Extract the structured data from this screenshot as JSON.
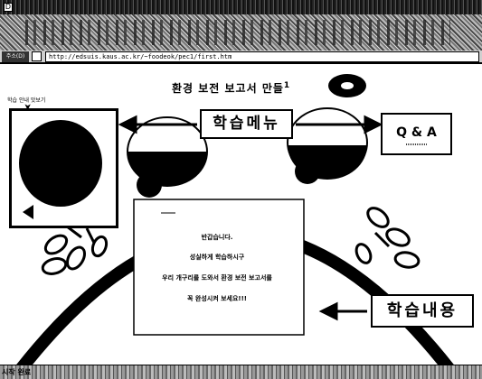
{
  "browser": {
    "system_icon": "D",
    "address_label": "주소(D)",
    "url": "http://edsuis.kaus.ac.kr/~foodeok/pec1/first.htm",
    "status_text": "시작 완료"
  },
  "page": {
    "title": "환경 보전 보고서 만들",
    "title_mark": "1",
    "small_label": "학습 안내 맛보기",
    "nav": {
      "learn_menu": "학습메뉴",
      "qa": "Q & A",
      "learn_content": "학습내용"
    },
    "message": [
      "반갑습니다.",
      "성실하게 학습하시구",
      "우리 개구리를 도와서 환경 보전 보고서를",
      "꼭 완성시켜 보세요!!!"
    ]
  },
  "colors": {
    "ink": "#000000",
    "paper": "#ffffff"
  }
}
